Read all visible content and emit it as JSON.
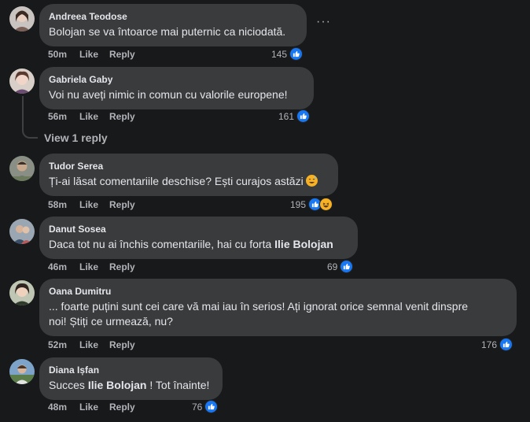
{
  "colors": {
    "background": "#18191a",
    "bubble": "#3a3b3c",
    "like_blue": "#1877f2",
    "haha_yellow": "#f7b125",
    "meta_gray": "#b0b3b8"
  },
  "actions": {
    "like": "Like",
    "reply": "Reply"
  },
  "view_replies": "View 1 reply",
  "comments": [
    {
      "author": "Andreea Teodose",
      "text": "Bolojan se va întoarce mai puternic ca niciodată.",
      "time": "50m",
      "reaction_count": "145",
      "reactions": [
        "like-icon"
      ]
    },
    {
      "author": "Gabriela Gaby",
      "text": "Voi nu aveți nimic in comun cu valorile europene!",
      "time": "56m",
      "reaction_count": "161",
      "reactions": [
        "like-icon"
      ]
    },
    {
      "author": "Tudor Serea",
      "text": "Ți-ai lăsat comentariile deschise? Ești curajos astăzi",
      "text_emoji": "sweat-smile-emoji",
      "time": "58m",
      "reaction_count": "195",
      "reactions": [
        "like-icon",
        "haha-icon"
      ]
    },
    {
      "author": "Danut Sosea",
      "text_before": "Daca tot nu ai închis comentariile, hai cu forta",
      "mention": "Ilie Bolojan",
      "time": "46m",
      "reaction_count": "69",
      "reactions": [
        "like-icon"
      ]
    },
    {
      "author": "Oana Dumitru",
      "text_line1": "... foarte puțini sunt cei care vă mai iau în serios! Ați ignorat orice semnal venit dinspre",
      "text_line2": "noi! Știți ce urmează, nu?",
      "time": "52m",
      "reaction_count": "176",
      "reactions": [
        "like-icon"
      ]
    },
    {
      "author": "Diana Ișfan",
      "text_before": "Succes",
      "mention": "Ilie Bolojan",
      "text_after": "! Tot înainte!",
      "time": "48m",
      "reaction_count": "76",
      "reactions": [
        "like-icon"
      ]
    }
  ]
}
